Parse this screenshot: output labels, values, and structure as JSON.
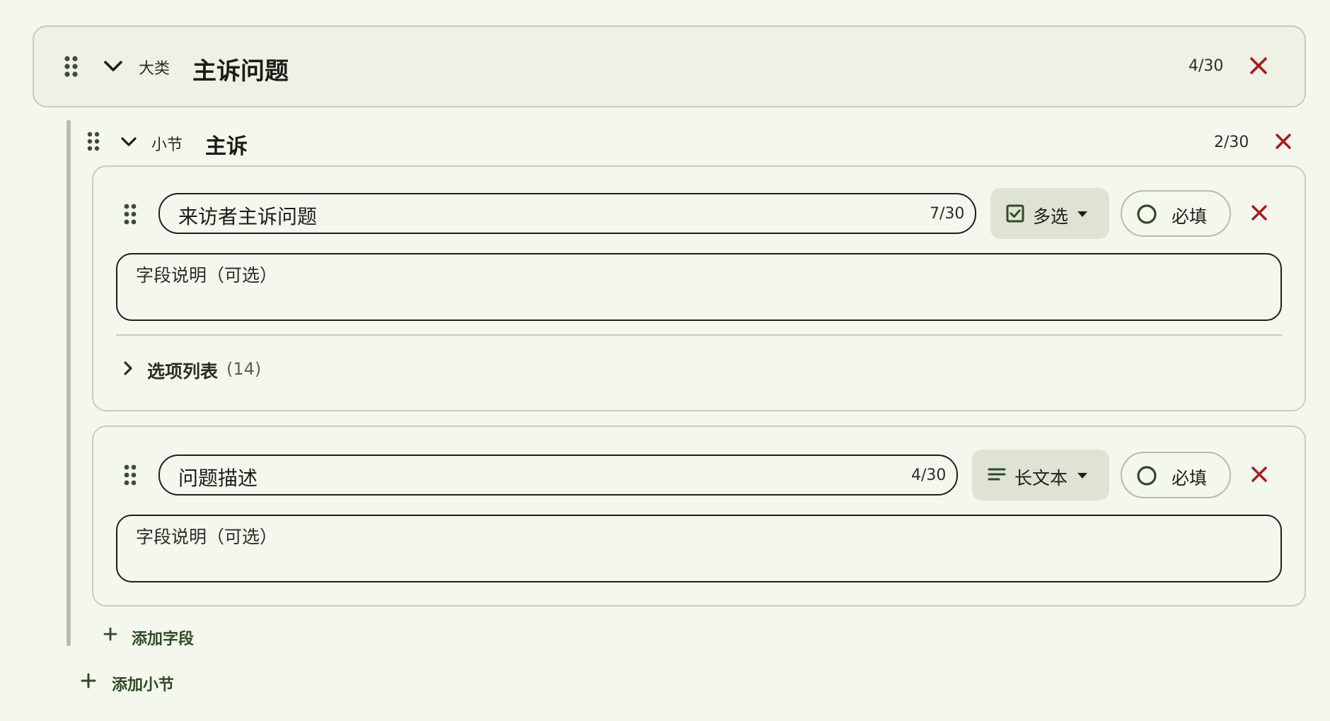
{
  "category": {
    "tag": "大类",
    "title": "主诉问题",
    "counter": "4/30"
  },
  "section": {
    "tag": "小节",
    "title": "主诉",
    "counter": "2/30"
  },
  "fields": [
    {
      "name": "来访者主诉问题",
      "counter": "7/30",
      "type_label": "多选",
      "type_icon": "checkbox-icon",
      "required_label": "必填",
      "description_placeholder": "字段说明（可选）",
      "options_label": "选项列表",
      "options_count": "(14)"
    },
    {
      "name": "问题描述",
      "counter": "4/30",
      "type_label": "长文本",
      "type_icon": "lines-icon",
      "required_label": "必填",
      "description_placeholder": "字段说明（可选）"
    }
  ],
  "actions": {
    "add_field": "添加字段",
    "add_section": "添加小节"
  },
  "colors": {
    "background": "#f4f8ec",
    "accent_close": "#b3131b",
    "accent_green": "#2f4a28",
    "type_button_bg": "#dfe3d3"
  }
}
